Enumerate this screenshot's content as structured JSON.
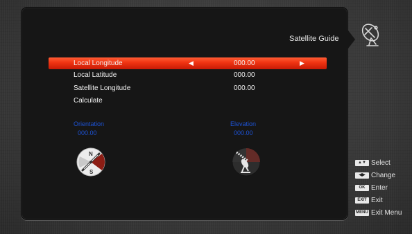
{
  "header": {
    "title": "Satellite Guide"
  },
  "settings": [
    {
      "label": "Local Longitude",
      "value": "000.00"
    },
    {
      "label": "Local Latitude",
      "value": "000.00"
    },
    {
      "label": "Satellite Longitude",
      "value": "000.00"
    },
    {
      "label": "Calculate",
      "value": ""
    }
  ],
  "results": {
    "orientation": {
      "label": "Orientation",
      "value": "000.00"
    },
    "elevation": {
      "label": "Elevation",
      "value": "000.00"
    }
  },
  "compass": {
    "north": "N",
    "south": "S"
  },
  "legend": [
    {
      "key": "▲▼",
      "label": "Select"
    },
    {
      "key": "◀▶",
      "label": "Change"
    },
    {
      "key": "OK",
      "label": "Enter"
    },
    {
      "key": "EXIT",
      "label": "Exit"
    },
    {
      "key": "MENU",
      "label": "Exit Menu"
    }
  ],
  "colors": {
    "selection": "#ef3311",
    "result_text": "#1d53d6",
    "panel": "#161616"
  }
}
